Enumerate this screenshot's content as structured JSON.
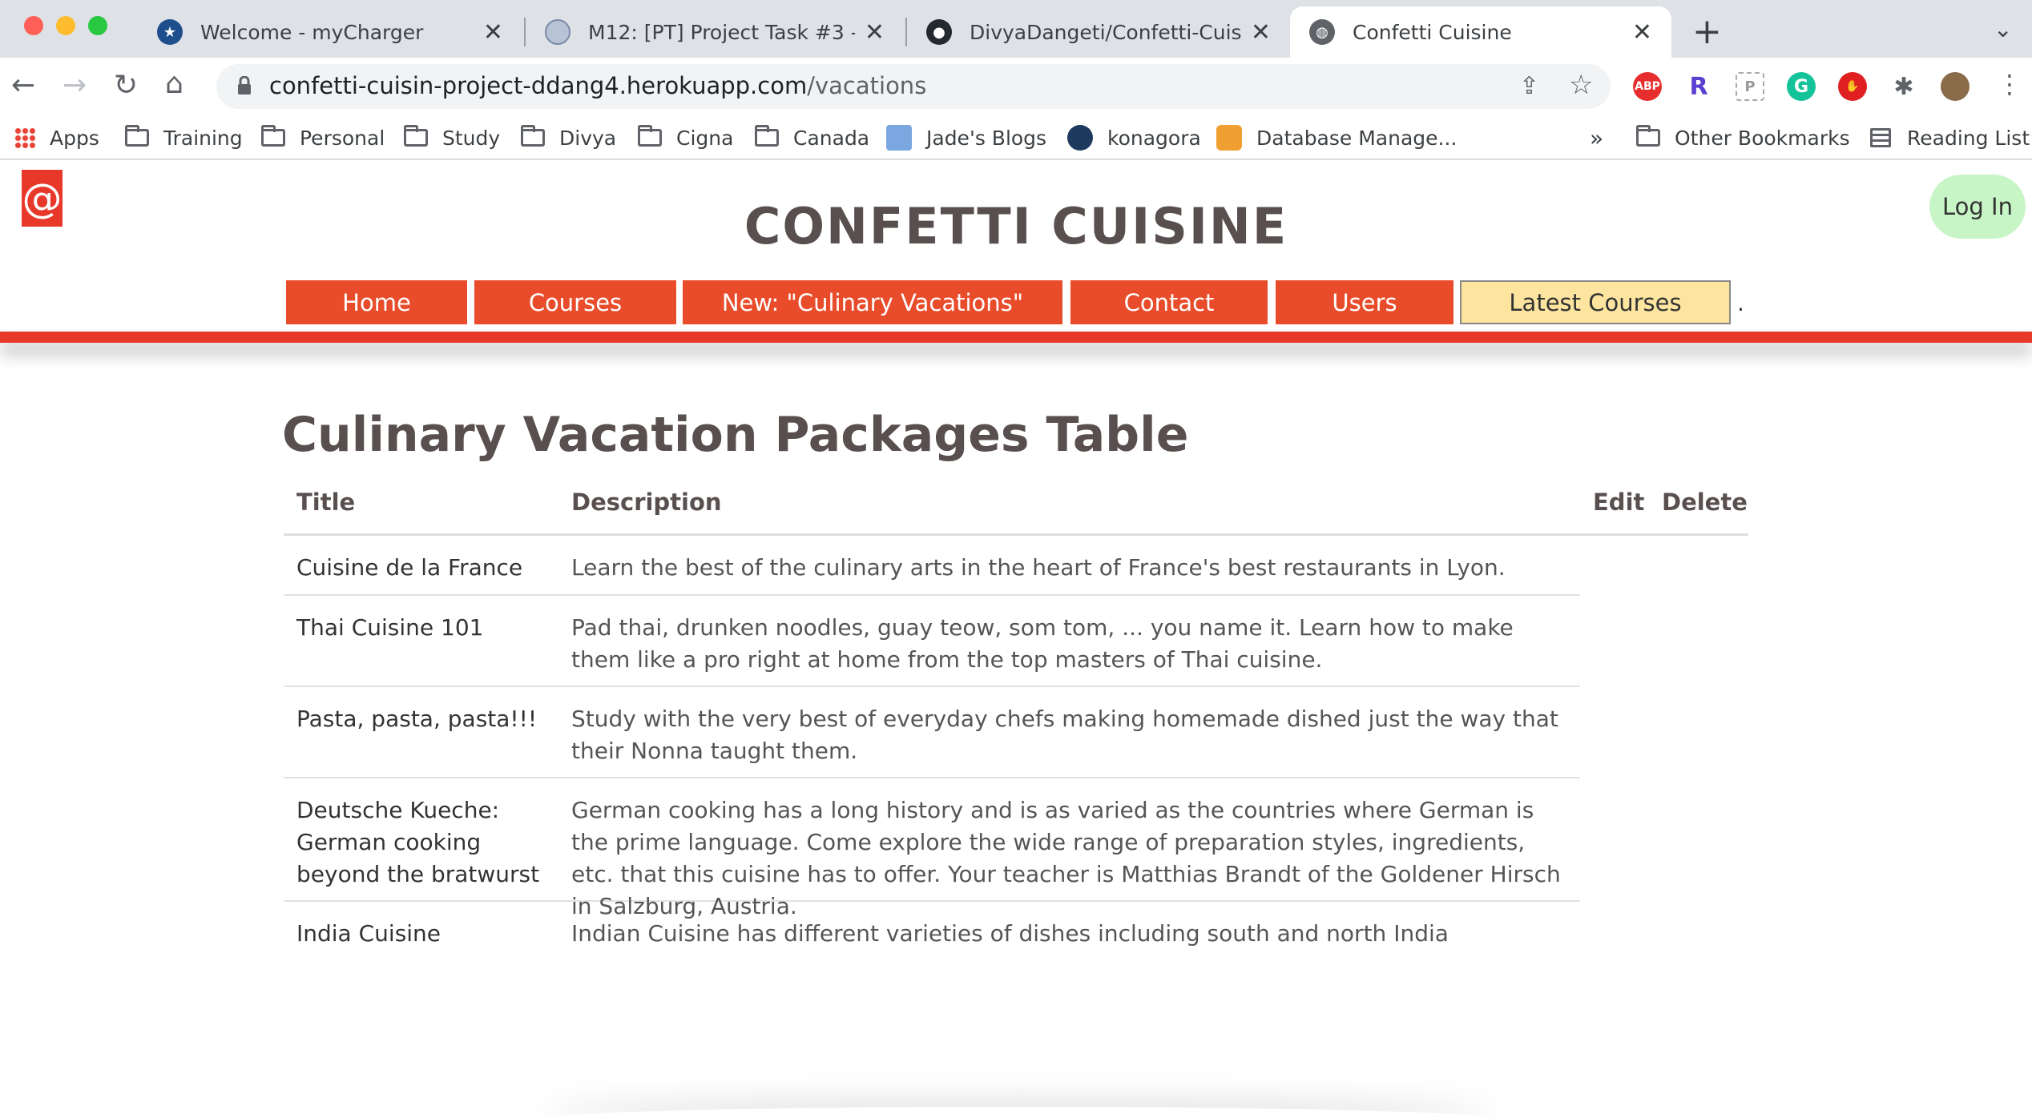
{
  "browser": {
    "tabs": [
      {
        "title": "Welcome - myCharger",
        "active": false
      },
      {
        "title": "M12: [PT] Project Task #3 - Enh",
        "active": false
      },
      {
        "title": "DivyaDangeti/Confetti-Cuisine-",
        "active": false
      },
      {
        "title": "Confetti Cuisine",
        "active": true
      }
    ],
    "url_host": "confetti-cuisin-project-ddang4.herokuapp.com",
    "url_path": "/vacations",
    "extensions": [
      "ABP",
      "R",
      "P",
      "G",
      "stop-icon",
      "puzzle-icon",
      "avatar"
    ],
    "bookmarks": [
      "Apps",
      "Training",
      "Personal",
      "Study",
      "Divya",
      "Cigna",
      "Canada",
      "Jade's Blogs",
      "konagora",
      "Database Manage..."
    ],
    "bookmarks_overflow": "»",
    "other_bookmarks": "Other Bookmarks",
    "reading_list": "Reading List"
  },
  "site": {
    "logo_glyph": "@",
    "title": "CONFETTI CUISINE",
    "login": "Log In",
    "nav": [
      "Home",
      "Courses",
      "New: \"Culinary Vacations\"",
      "Contact",
      "Users",
      "Latest Courses"
    ],
    "nav_trailing": ".",
    "accent_color": "#e84c2b",
    "highlight_color": "#fde5a0"
  },
  "main": {
    "heading": "Culinary Vacation Packages Table",
    "columns": {
      "title": "Title",
      "description": "Description",
      "edit": "Edit",
      "delete": "Delete"
    },
    "rows": [
      {
        "title": "Cuisine de la France",
        "description": "Learn the best of the culinary arts in the heart of France's best restaurants in Lyon."
      },
      {
        "title": "Thai Cuisine 101",
        "description": "Pad thai, drunken noodles, guay teow, som tom, ... you name it. Learn how to make them like a pro right at home from the top masters of Thai cuisine."
      },
      {
        "title": "Pasta, pasta, pasta!!!",
        "description": "Study with the very best of everyday chefs making homemade dished just the way that their Nonna taught them."
      },
      {
        "title": "Deutsche Kueche: German cooking beyond the bratwurst",
        "description": "German cooking has a long history and is as varied as the countries where German is the prime language. Come explore the wide range of preparation styles, ingredients, etc. that this cuisine has to offer. Your teacher is Matthias Brandt of the Goldener Hirsch in Salzburg, Austria."
      },
      {
        "title": "India Cuisine",
        "description": "Indian Cuisine has different varieties of dishes including south and north India"
      }
    ]
  }
}
